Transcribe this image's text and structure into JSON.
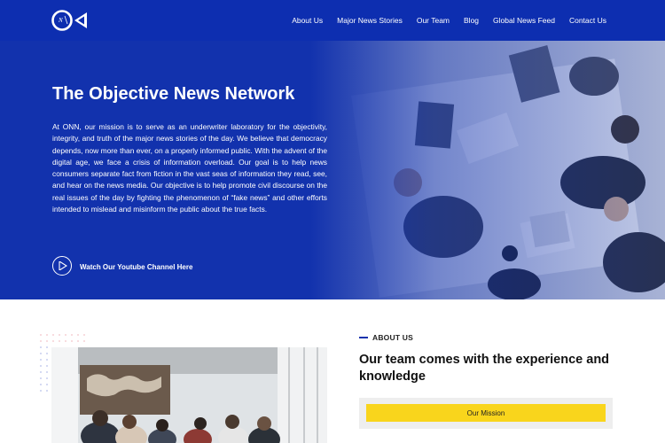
{
  "header": {
    "logo_text": "ON",
    "nav": [
      {
        "label": "About Us"
      },
      {
        "label": "Major News Stories"
      },
      {
        "label": "Our Team"
      },
      {
        "label": "Blog"
      },
      {
        "label": "Global News Feed"
      },
      {
        "label": "Contact Us"
      }
    ]
  },
  "hero": {
    "title": "The Objective News Network",
    "body": "At ONN, our mission is to serve as an underwriter laboratory for the objectivity, integrity, and truth of the major news stories of the day. We believe that democracy depends, now more than ever, on a properly informed public. With the advent of the digital age, we face a crisis of information overload. Our goal is to help news consumers separate fact from fiction in the vast seas of information they read, see, and hear on the news media. Our objective is to help promote civil discourse on the real issues of the day by fighting the phenomenon of “fake news” and other efforts intended to mislead and misinform the public about the true facts.",
    "video_link": "Watch Our Youtube Channel Here"
  },
  "about": {
    "label": "ABOUT US",
    "heading": "Our team comes with the experience and knowledge",
    "mission_button": "Our Mission"
  },
  "colors": {
    "brand_blue": "#0d2eb0",
    "accent_yellow": "#f9d51c"
  }
}
